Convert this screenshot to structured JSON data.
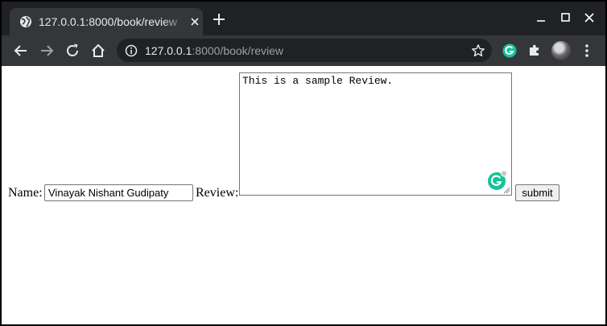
{
  "browser": {
    "tab_title": "127.0.0.1:8000/book/review",
    "url_host": "127.0.0.1",
    "url_rest": ":8000/book/review"
  },
  "form": {
    "name_label": "Name:",
    "name_value": "Vinayak Nishant Gudipaty",
    "review_label": "Review:",
    "review_value": "This is a sample Review.",
    "submit_label": "submit"
  },
  "icons": {
    "tab_favicon": "globe-icon",
    "tab_close": "close-icon",
    "new_tab": "plus-icon",
    "minimize": "minimize-icon",
    "maximize": "maximize-icon",
    "close_window": "close-icon",
    "back": "back-arrow-icon",
    "forward": "forward-arrow-icon",
    "reload": "reload-icon",
    "home": "home-icon",
    "site_info": "info-icon",
    "bookmark": "star-icon",
    "grammarly_extension": "grammarly-icon",
    "extensions": "puzzle-icon",
    "profile": "avatar",
    "menu": "kebab-menu-icon"
  },
  "colors": {
    "tab_strip": "#202124",
    "toolbar": "#35363a",
    "grammarly": "#15c39a"
  }
}
